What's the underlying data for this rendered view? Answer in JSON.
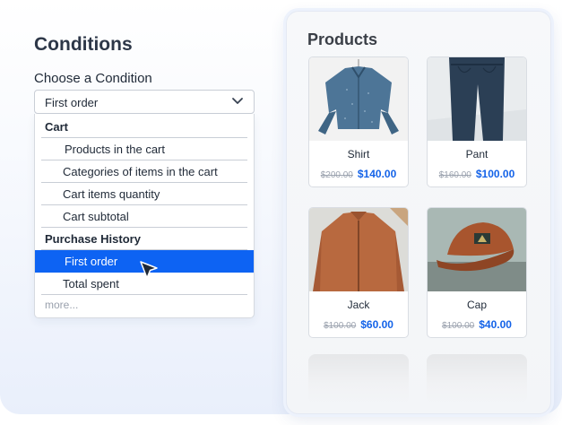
{
  "conditions": {
    "title": "Conditions",
    "choose_label": "Choose a Condition",
    "select_value": "First order",
    "dropdown": {
      "groups": [
        {
          "label": "Cart",
          "items": [
            "Products in the cart",
            "Categories of items in the cart",
            "Cart items quantity",
            "Cart subtotal"
          ]
        },
        {
          "label": "Purchase History",
          "items": [
            "First order",
            "Total spent"
          ]
        }
      ],
      "selected": "First order",
      "more_label": "more..."
    },
    "accent_color": "#0d63f3"
  },
  "products": {
    "title": "Products",
    "items": [
      {
        "name": "Shirt",
        "old_price": "$200.00",
        "new_price": "$140.00"
      },
      {
        "name": "Pant",
        "old_price": "$160.00",
        "new_price": "$100.00"
      },
      {
        "name": "Jack",
        "old_price": "$100.00",
        "new_price": "$60.00"
      },
      {
        "name": "Cap",
        "old_price": "$100.00",
        "new_price": "$40.00"
      }
    ],
    "price_color": "#1463e8"
  }
}
